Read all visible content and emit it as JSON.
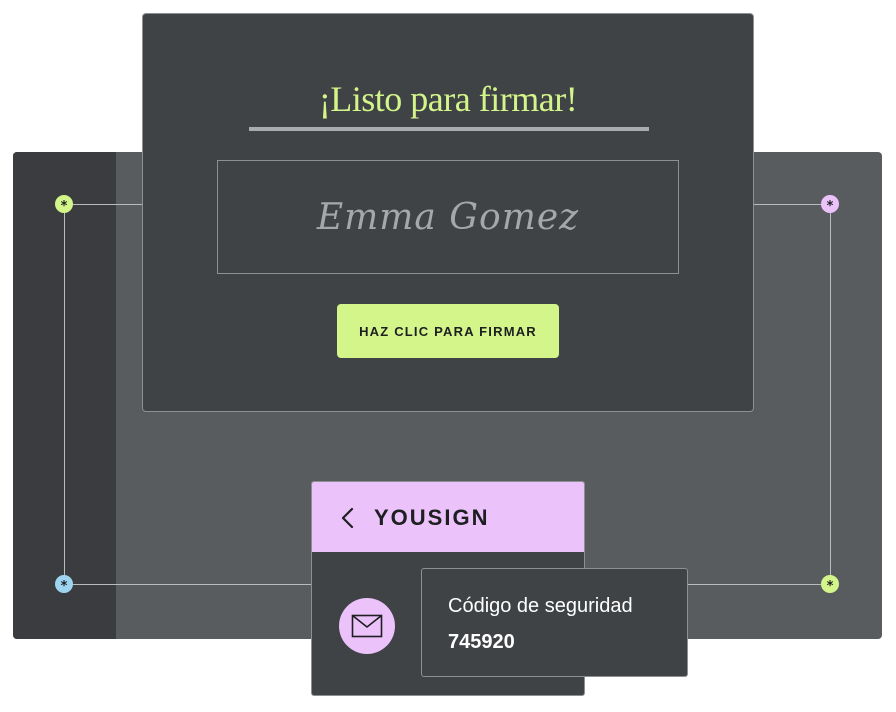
{
  "sign_panel": {
    "title": "¡Listo para firmar!",
    "signature_name": "Emma Gomez",
    "button_label": "HAZ CLIC PARA FIRMAR"
  },
  "app_card": {
    "app_name": "YOUSIGN",
    "back_icon": "chevron-left-icon",
    "mail_icon": "envelope-icon"
  },
  "code_card": {
    "label": "Código de seguridad",
    "code": "745920"
  },
  "nodes": {
    "glyph": "*",
    "top_left_color": "#d4f58a",
    "top_right_color": "#ecc2fb",
    "bottom_left_color": "#9fd4f0",
    "bottom_right_color": "#d4f58a"
  },
  "colors": {
    "accent_green": "#d4f58a",
    "accent_pink": "#ecc2fb",
    "panel_dark": "#404346",
    "backdrop": "#595c5f"
  }
}
